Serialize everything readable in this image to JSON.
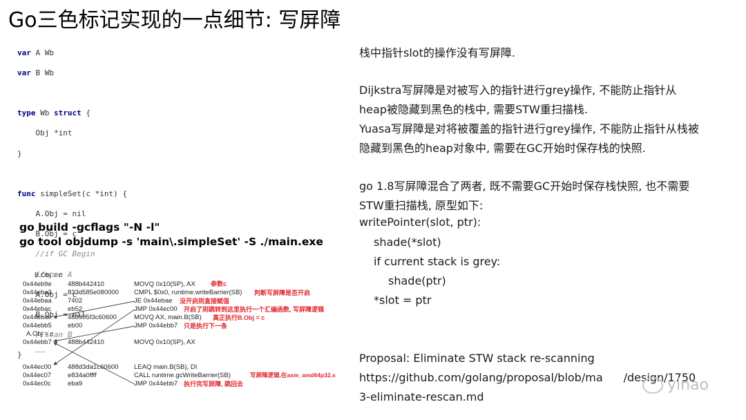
{
  "title": "Go三色标记实现的一点细节: 写屏障",
  "code": {
    "l1_kw": "var",
    "l1_rest": " A Wb",
    "l2_kw": "var",
    "l2_rest": " B Wb",
    "l4_kw1": "type",
    "l4_mid": " Wb ",
    "l4_kw2": "struct",
    "l4_rest": " {",
    "l5": "    Obj *int",
    "l6": "}",
    "l8_kw": "func",
    "l8_rest": " simpleSet(c *int) {",
    "l9": "    A.Obj = nil",
    "l10": "    B.Obj = c",
    "l11": "    //if GC Begin",
    "l12": "    //scan A",
    "l13": "    A.Obj = c",
    "l14": "    B.Obj = nil",
    "l15": "    //scan B",
    "l16": "}"
  },
  "commands": [
    "go build -gcflags \"-N -l\"",
    "go tool objdump -s 'main\\.simpleSet' -S ./main.exe"
  ],
  "asm": {
    "b_obj": "B.Obj = c",
    "a_obj": "A.Obj = c",
    "ellipsis": "......",
    "rows": [
      {
        "addr": "0x44eb9e",
        "hex": "488b442410",
        "ins": "MOVQ 0x10(SP), AX",
        "note": "参数c"
      },
      {
        "addr": "0x44eba3",
        "hex": "833d585e080000",
        "ins": "CMPL $0x0, runtime.writeBarrier(SB)",
        "note": "判断写屏障是否开启"
      },
      {
        "addr": "0x44ebaa",
        "hex": "7402",
        "ins": "JE 0x44ebae",
        "note": "没开启则直接赋值"
      },
      {
        "addr": "0x44ebac",
        "hex": "eb52",
        "ins": "JMP 0x44ec00",
        "note": "开启了则跳转到这里执行一个汇编函数, 写屏障逻辑"
      },
      {
        "addr": "0x44ebae",
        "hex": "488905f3c60600",
        "ins": "MOVQ AX, main.B(SB)",
        "note": "真正执行B.Obj = c"
      },
      {
        "addr": "0x44ebb5",
        "hex": "eb00",
        "ins": "JMP 0x44ebb7",
        "note": "只是执行下一条"
      },
      {
        "addr": "0x44ebb7",
        "hex": "488b442410",
        "ins": "MOVQ 0x10(SP), AX",
        "note": ""
      },
      {
        "addr": "0x44ec00",
        "hex": "488d3da1c60600",
        "ins": "LEAQ main.B(SB), DI",
        "note": ""
      },
      {
        "addr": "0x44ec07",
        "hex": "e834a0ffff",
        "ins": "CALL runtime.gcWriteBarrier(SB)",
        "note": "写屏障逻辑,在asm_amd64p32.s"
      },
      {
        "addr": "0x44ec0c",
        "hex": "eba9",
        "ins": "JMP 0x44ebb7",
        "note": "执行完写屏障, 跳回去"
      }
    ]
  },
  "right": {
    "p1": "栈中指针slot的操作没有写屏障.",
    "p2a": "Dijkstra写屏障是对被写入的指针进行grey操作, 不能防止指针从",
    "p2b": "heap被隐藏到黑色的栈中, 需要STW重扫描栈.",
    "p3a": "Yuasa写屏障是对将被覆盖的指针进行grey操作, 不能防止指针从栈被",
    "p3b": "隐藏到黑色的heap对象中, 需要在GC开始时保存栈的快照.",
    "p4a": "go 1.8写屏障混合了两者, 既不需要GC开始时保存栈快照, 也不需要",
    "p4b": "STW重扫描栈, 原型如下:",
    "c1": "writePointer(slot, ptr):",
    "c2": "shade(*slot)",
    "c3": "if current stack is grey:",
    "c4": "shade(ptr)",
    "c5": "*slot = ptr",
    "p5": "Proposal: Eliminate STW stack re-scanning",
    "p6a": "https://github.com/golang/proposal/blob/ma",
    "p6b": "/design/1750",
    "p7": "3-eliminate-rescan.md"
  },
  "watermark": "yinao",
  "colors": {
    "note": "#e0282e",
    "keyword": "#000080",
    "comment": "#8a8a8a"
  }
}
